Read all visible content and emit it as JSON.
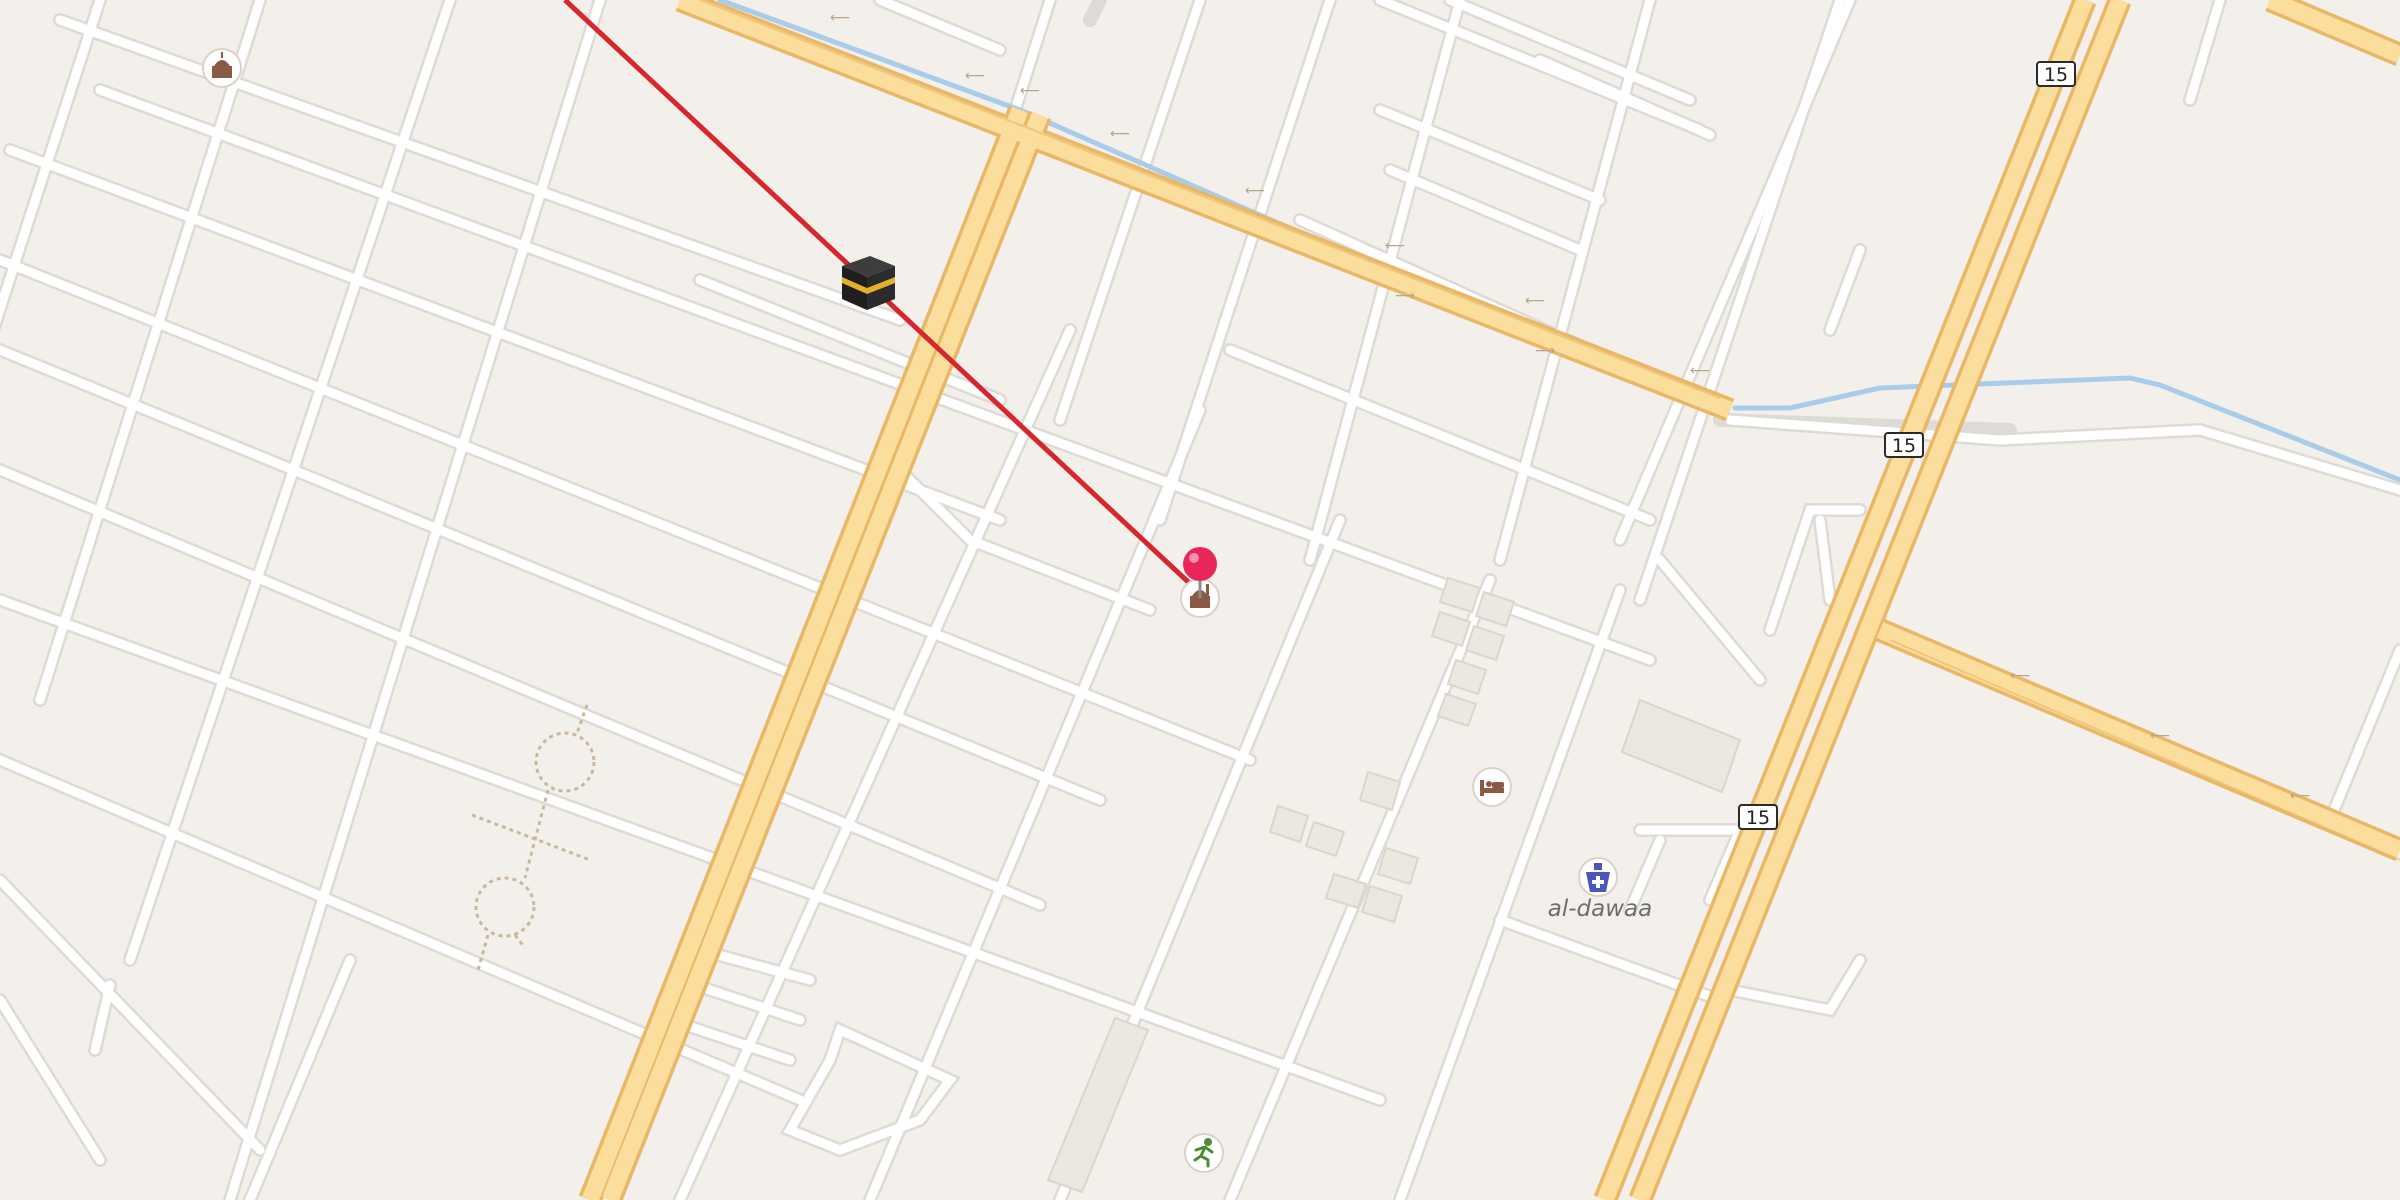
{
  "map": {
    "colors": {
      "background": "#f3f0ec",
      "street": "#ffffff",
      "street_casing": "#dedbd6",
      "highway_fill": "#fbdd9c",
      "highway_casing": "#e9b766",
      "water": "#a9ccea",
      "building": "#ece7e1",
      "route_line": "#d7262e",
      "pin": "#e8265a"
    },
    "route_shields": [
      {
        "ref": "15"
      },
      {
        "ref": "15"
      },
      {
        "ref": "15"
      }
    ],
    "pois": [
      {
        "name": "mosque",
        "icon": "mosque-icon"
      },
      {
        "name": "mosque",
        "icon": "mosque-icon"
      },
      {
        "name": "hotel",
        "icon": "bed-icon"
      },
      {
        "name": "pharmacy",
        "icon": "pharmacy-icon",
        "label": "al-dawaa"
      },
      {
        "name": "sports",
        "icon": "running-person-icon"
      },
      {
        "name": "kaaba",
        "icon": "kaaba-icon"
      }
    ],
    "qibla_line": {
      "from": "selected location pin",
      "to": "kaaba-icon"
    }
  }
}
